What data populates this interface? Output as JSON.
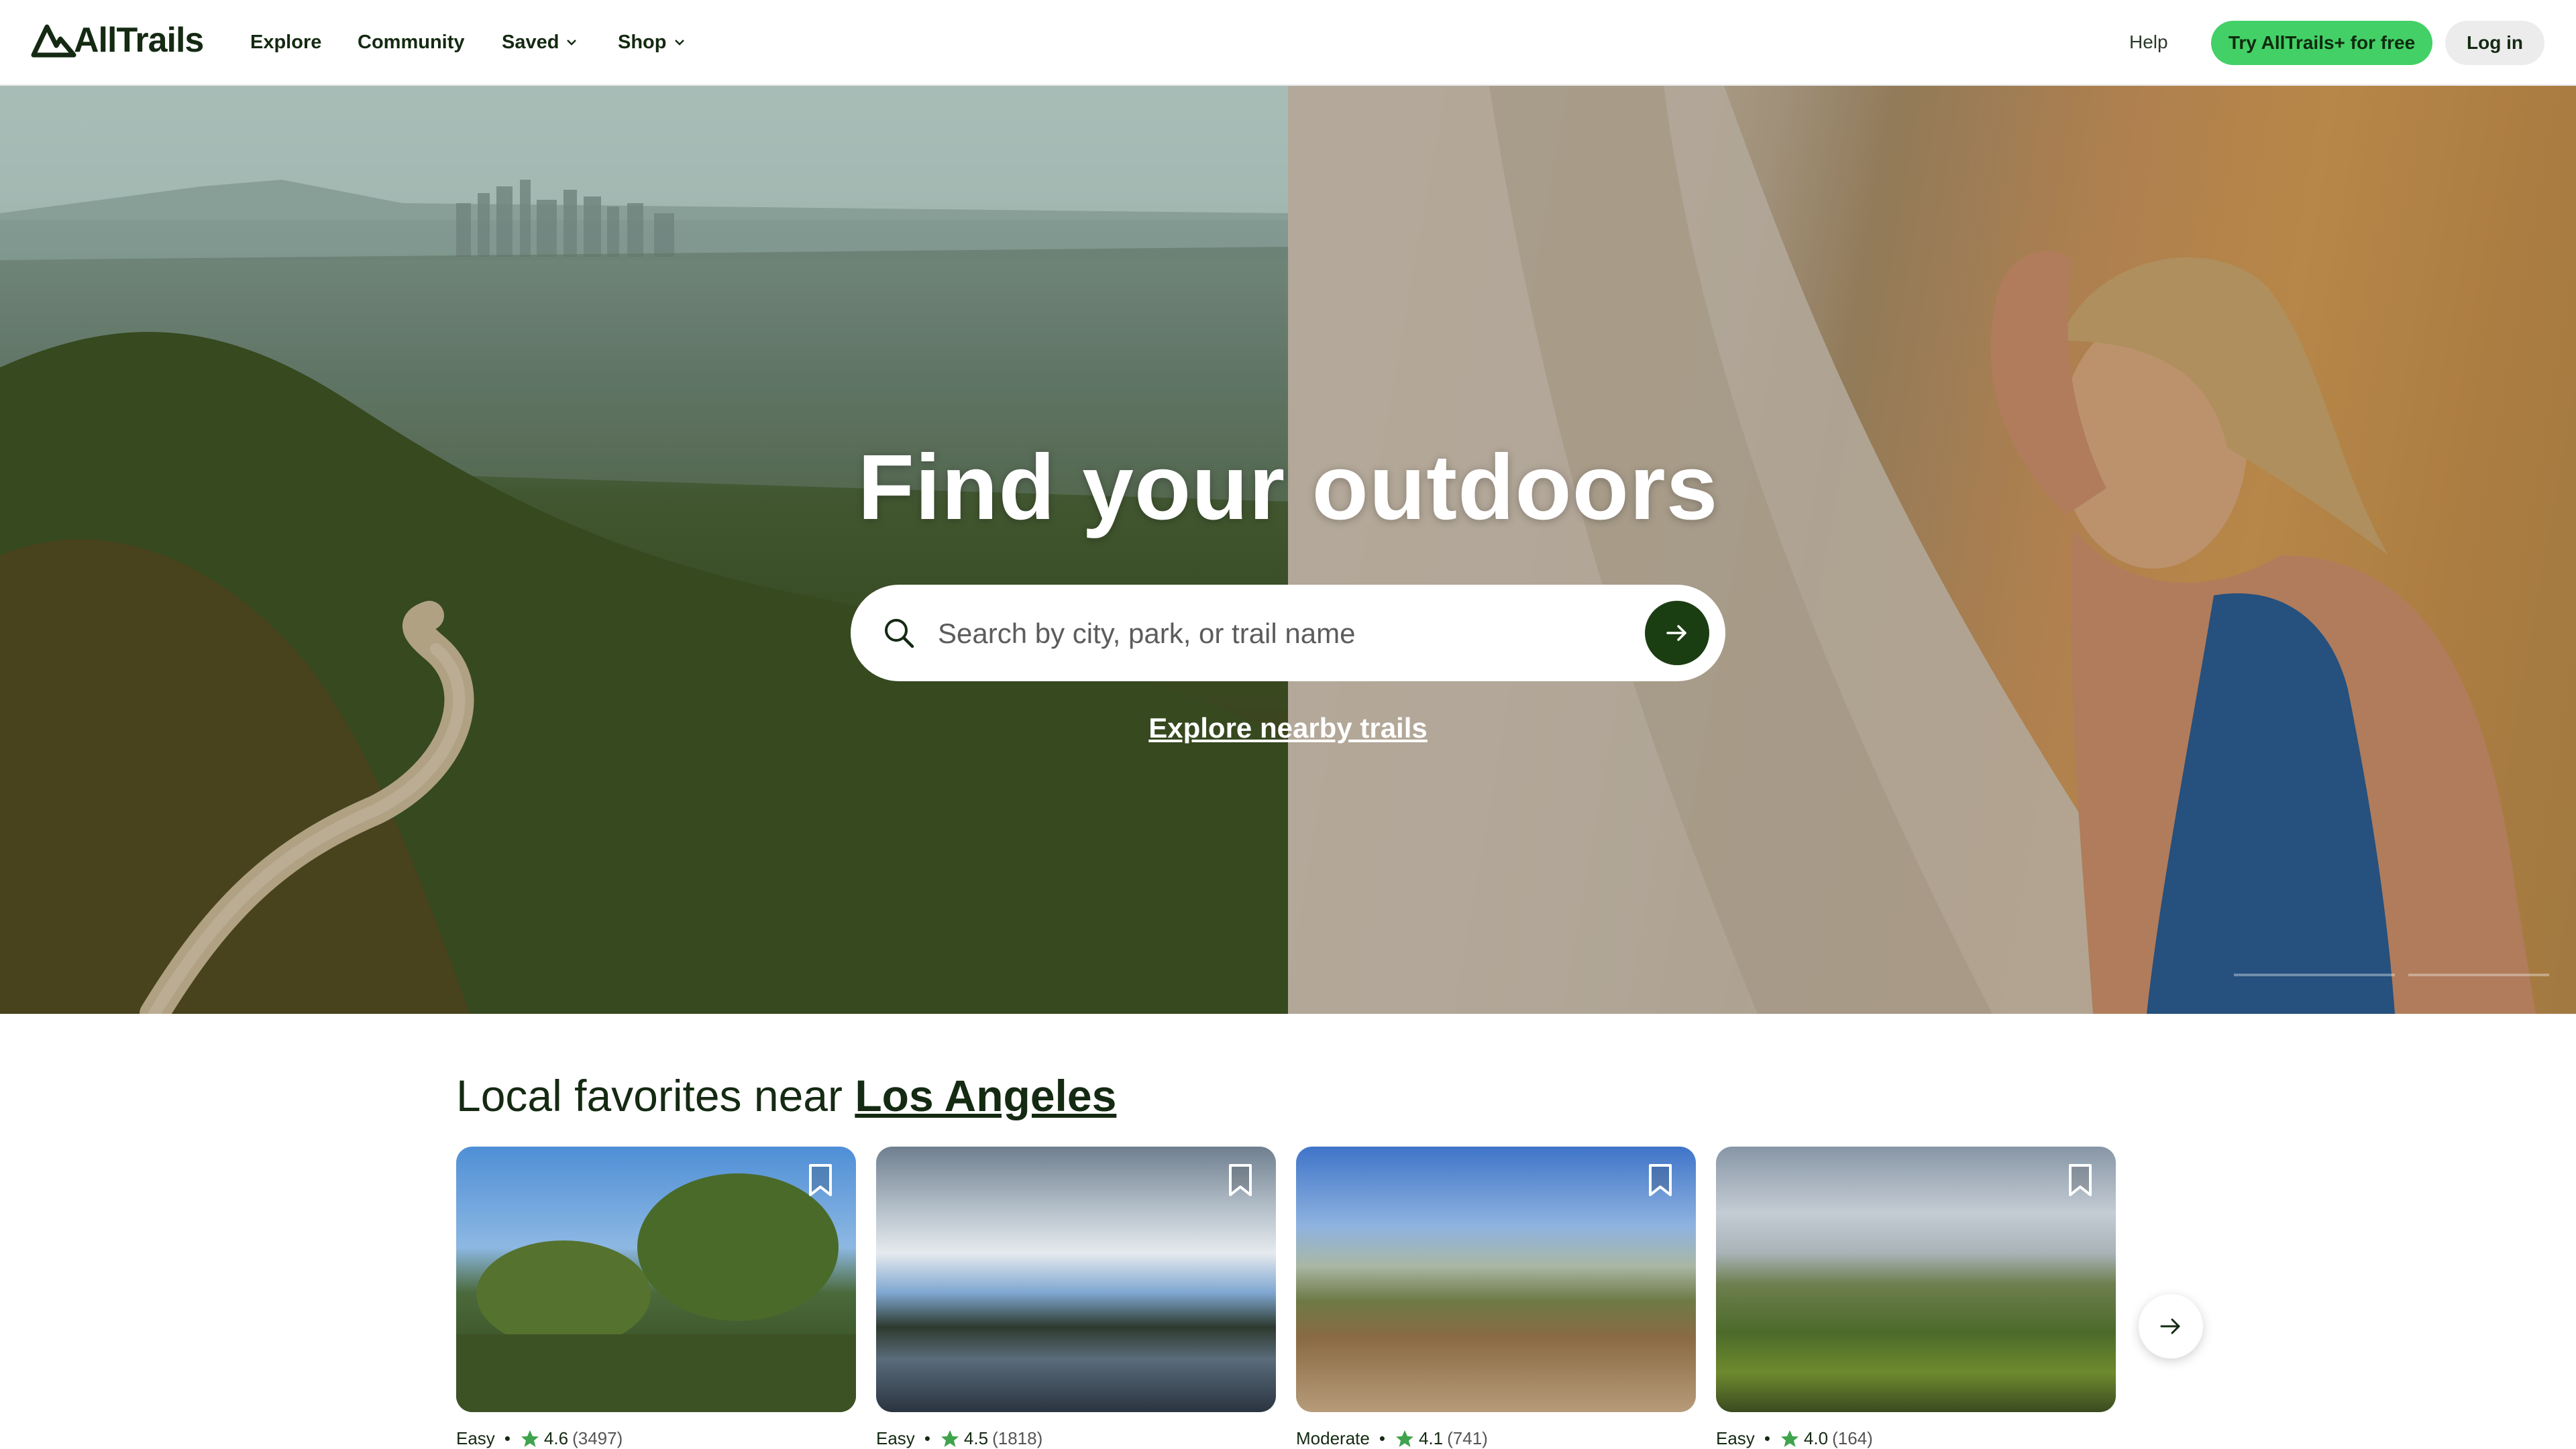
{
  "header": {
    "logo_text": "AllTrails",
    "nav": [
      {
        "label": "Explore",
        "has_dropdown": false
      },
      {
        "label": "Community",
        "has_dropdown": false
      },
      {
        "label": "Saved",
        "has_dropdown": true
      },
      {
        "label": "Shop",
        "has_dropdown": true
      }
    ],
    "help_label": "Help",
    "try_label": "Try AllTrails+ for free",
    "login_label": "Log in"
  },
  "hero": {
    "title": "Find your outdoors",
    "search_placeholder": "Search by city, park, or trail name",
    "explore_link": "Explore nearby trails"
  },
  "favorites": {
    "title_prefix": "Local favorites near ",
    "location": "Los Angeles",
    "cards": [
      {
        "difficulty": "Easy",
        "rating": "4.6",
        "reviews": "(3497)"
      },
      {
        "difficulty": "Easy",
        "rating": "4.5",
        "reviews": "(1818)"
      },
      {
        "difficulty": "Moderate",
        "rating": "4.1",
        "reviews": "(741)"
      },
      {
        "difficulty": "Easy",
        "rating": "4.0",
        "reviews": "(164)"
      }
    ]
  },
  "icons": {
    "logo": "mountain-logo-icon",
    "search": "search-icon",
    "go": "arrow-right-icon",
    "bookmark": "bookmark-icon",
    "star": "star-icon",
    "next": "arrow-right-icon"
  },
  "colors": {
    "brand_green": "#43d067",
    "dark_green": "#1b3d12",
    "text": "#142a12",
    "star": "#3fa34d"
  }
}
